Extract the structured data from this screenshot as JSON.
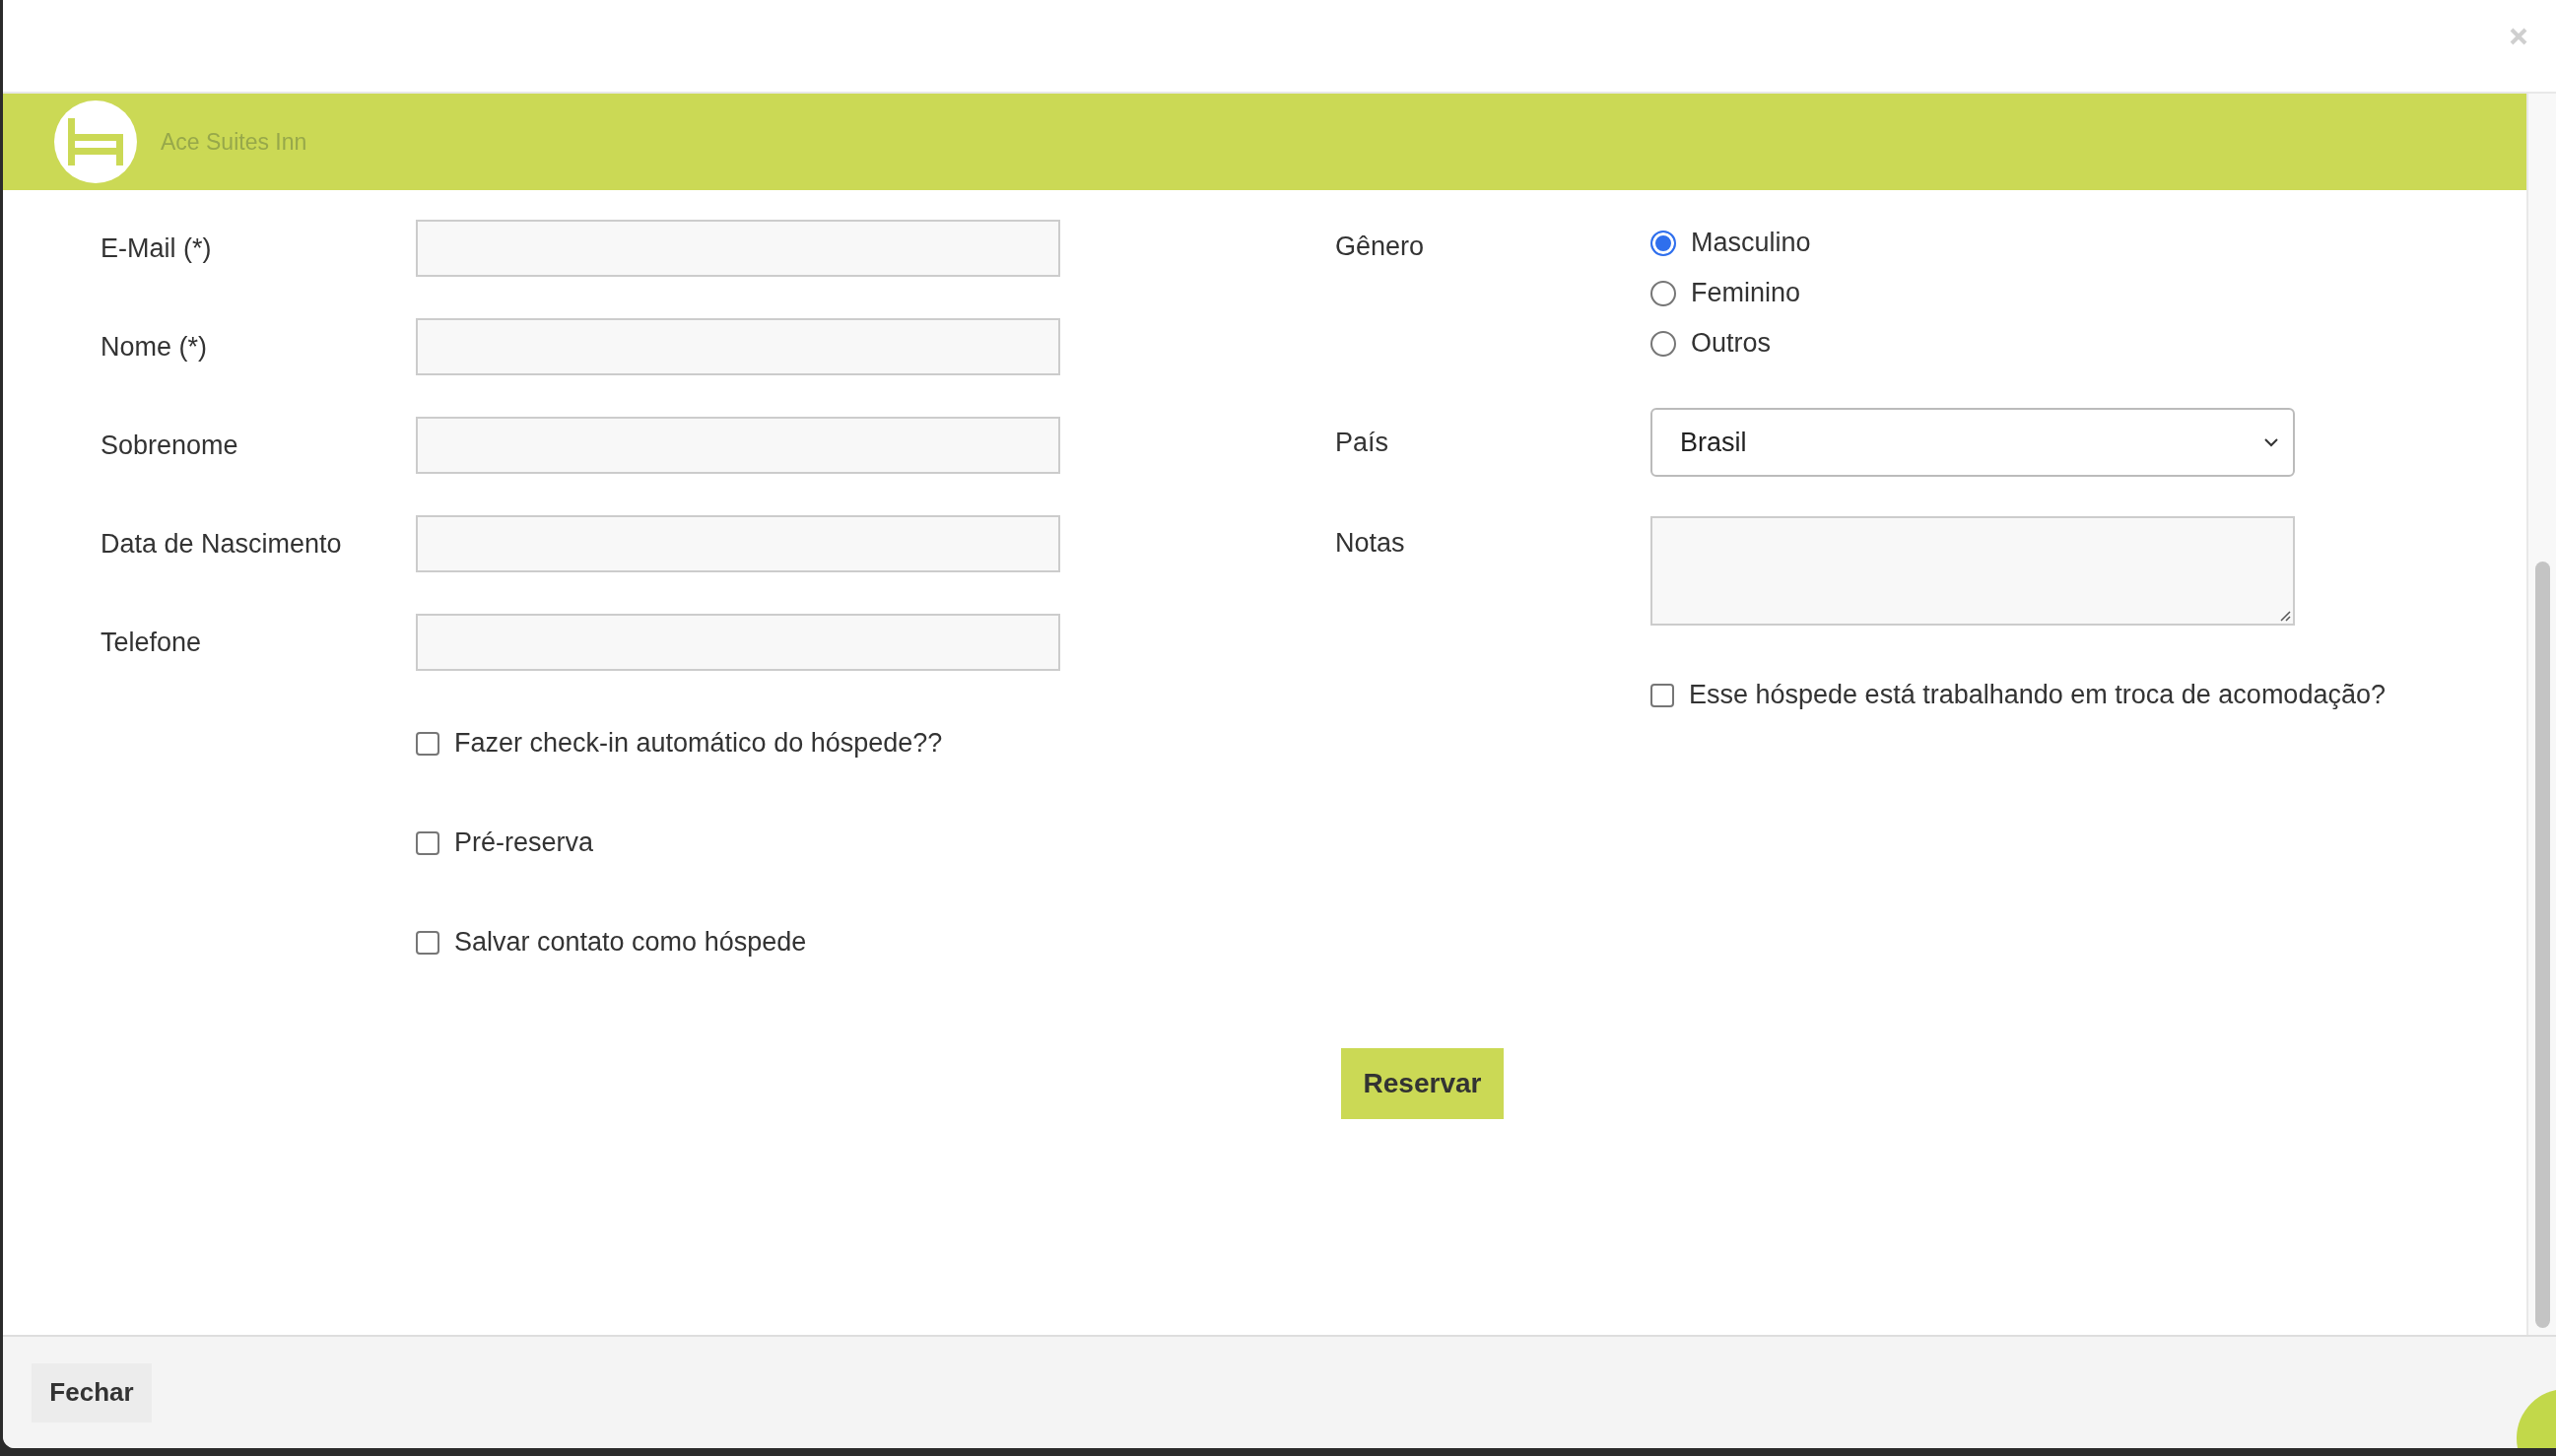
{
  "header": {
    "title": "Ace Suites Inn"
  },
  "fields": [
    {
      "label": "E-Mail (*)"
    },
    {
      "label": "Nome (*)"
    },
    {
      "label": "Sobrenome"
    },
    {
      "label": "Data de Nascimento"
    },
    {
      "label": "Telefone"
    }
  ],
  "left_checkboxes": [
    {
      "label": "Fazer check-in automático do hóspede??",
      "checked": false
    },
    {
      "label": "Pré-reserva",
      "checked": false
    },
    {
      "label": "Salvar contato como hóspede",
      "checked": false
    }
  ],
  "gender": {
    "label": "Gênero",
    "options": [
      {
        "label": "Masculino",
        "selected": true
      },
      {
        "label": "Feminino",
        "selected": false
      },
      {
        "label": "Outros",
        "selected": false
      }
    ]
  },
  "country": {
    "label": "País",
    "value": "Brasil"
  },
  "notes": {
    "label": "Notas"
  },
  "work_exchange": {
    "label": "Esse hóspede está trabalhando em troca de acomodação?",
    "checked": false
  },
  "submit_button": "Reservar",
  "footer": {
    "close_button": "Fechar"
  }
}
